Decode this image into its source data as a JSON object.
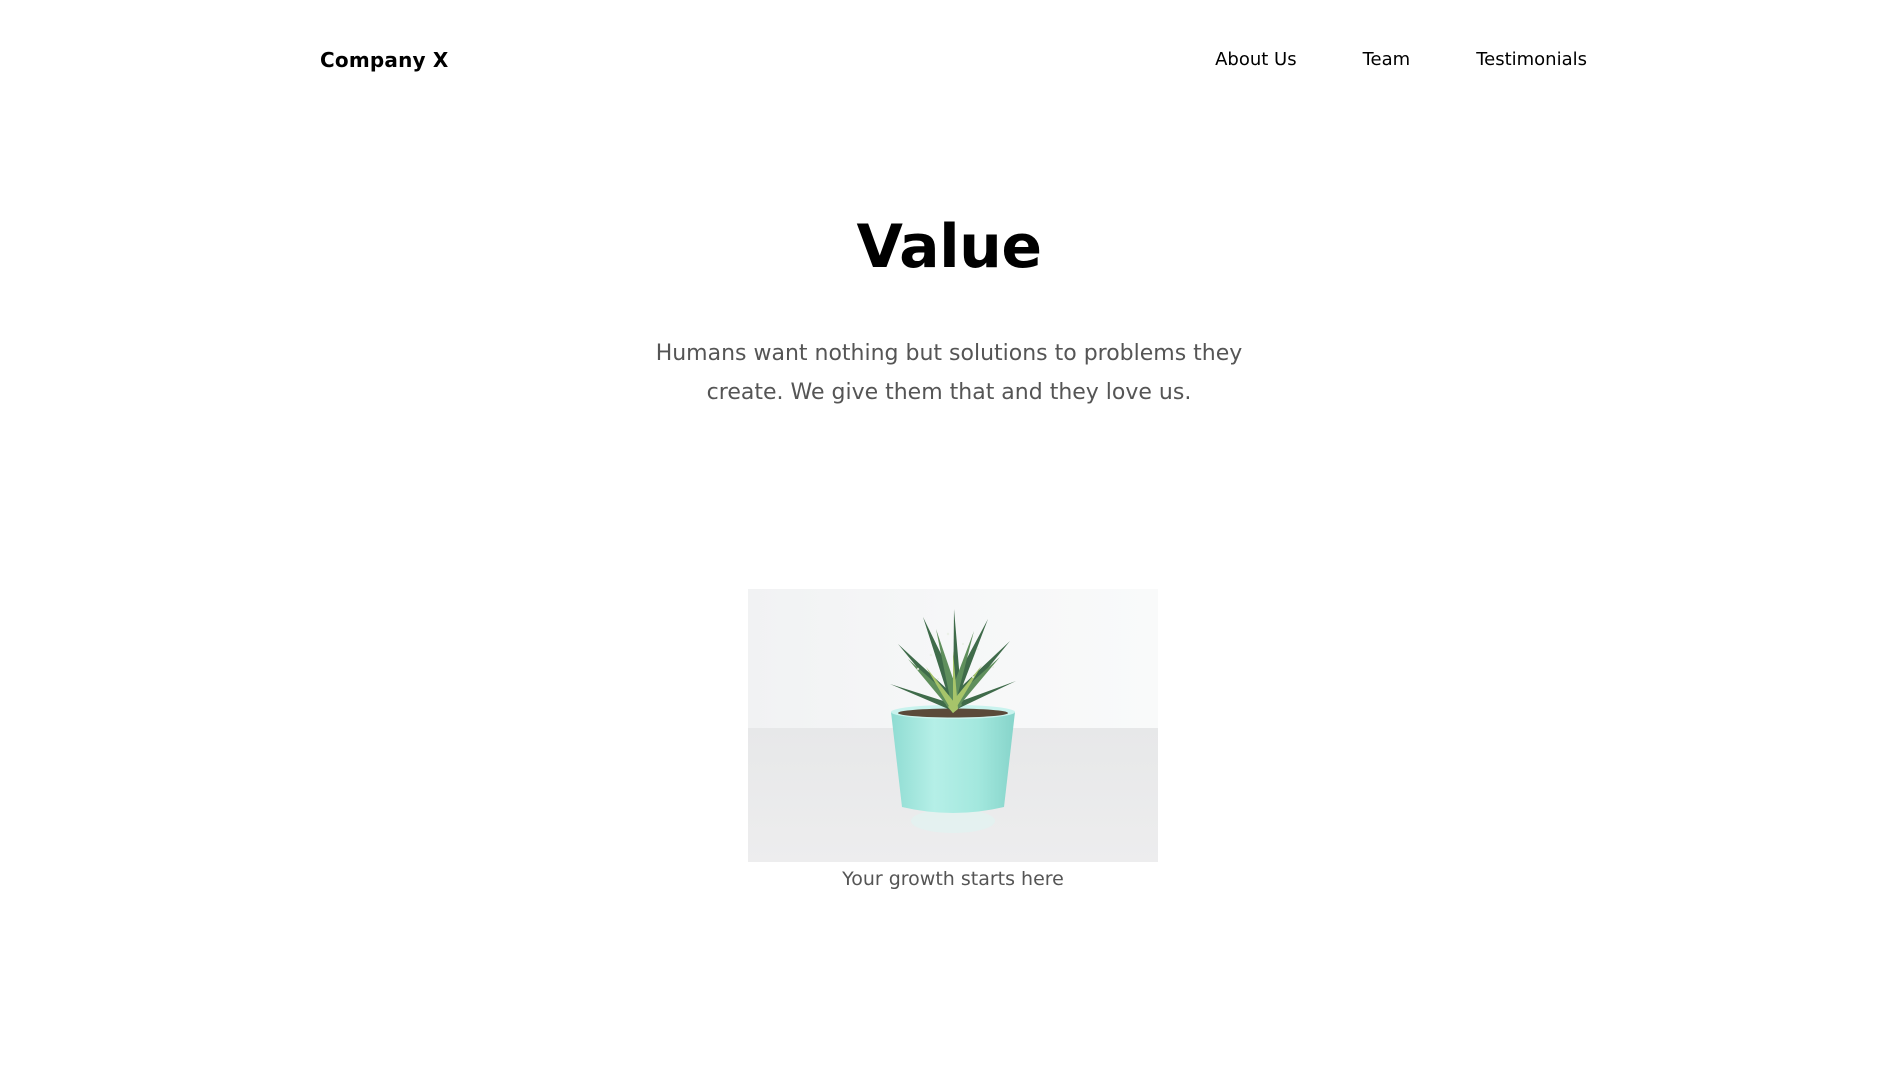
{
  "header": {
    "brand": "Company X",
    "nav": [
      {
        "label": "About Us"
      },
      {
        "label": "Team"
      },
      {
        "label": "Testimonials"
      }
    ]
  },
  "hero": {
    "title": "Value",
    "text": "Humans want nothing but solutions to problems they create. We give them that and they love us."
  },
  "figure": {
    "image_subject": "succulent-in-mint-pot",
    "caption": "Your growth starts here"
  }
}
